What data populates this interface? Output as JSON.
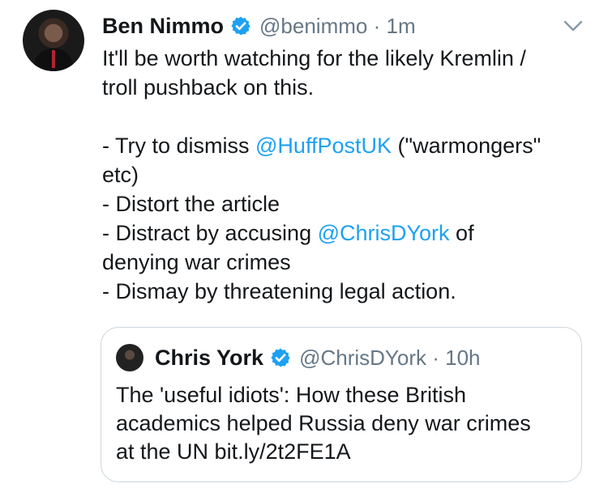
{
  "author": {
    "name": "Ben Nimmo",
    "handle": "@benimmo",
    "separator": "·",
    "time": "1m"
  },
  "body": {
    "line1": "It'll be worth watching for the likely Kremlin /",
    "line2": "troll pushback on this.",
    "line3_pre": "- Try to dismiss ",
    "line3_mention": "@HuffPostUK",
    "line3_post": " (\"warmongers\"",
    "line4": "etc)",
    "line5": "- Distort the article",
    "line6_pre": "- Distract by accusing ",
    "line6_mention": "@ChrisDYork",
    "line6_post": " of",
    "line7": "denying war crimes",
    "line8": "- Dismay by threatening legal action."
  },
  "quoted": {
    "name": "Chris York",
    "handle": "@ChrisDYork",
    "separator": "·",
    "time": "10h",
    "text_line1": "The 'useful idiots': How these British",
    "text_line2": "academics helped Russia deny war crimes",
    "text_line3": "at the UN bit.ly/2t2FE1A"
  },
  "icons": {
    "verified": "verified-badge-icon",
    "menu": "chevron-down-icon"
  },
  "colors": {
    "link": "#1da1f2",
    "verified": "#1da1f2",
    "muted": "#657786",
    "text": "#14171a",
    "border": "#ccd6dd"
  }
}
